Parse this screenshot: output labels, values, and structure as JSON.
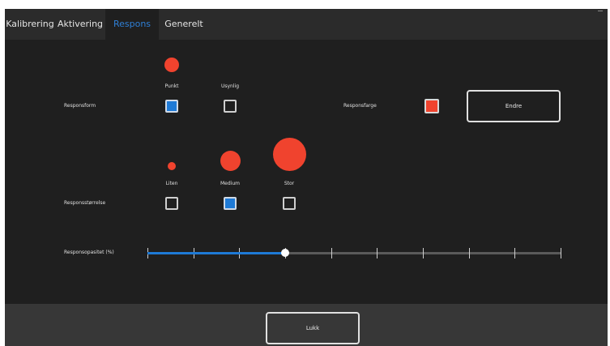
{
  "tabs": [
    {
      "label": "Kalibrering",
      "active": false
    },
    {
      "label": "Aktivering",
      "active": false
    },
    {
      "label": "Respons",
      "active": true
    },
    {
      "label": "Generelt",
      "active": false
    }
  ],
  "response_shape": {
    "label": "Responsform",
    "options": [
      {
        "label": "Punkt",
        "selected": true
      },
      {
        "label": "Usynlig",
        "selected": false
      }
    ]
  },
  "response_color": {
    "label": "Responsfarge",
    "swatch_color": "#f0432e",
    "change_button": "Endre"
  },
  "response_size": {
    "label": "Responsstørrelse",
    "options": [
      {
        "label": "Liten",
        "selected": false
      },
      {
        "label": "Medium",
        "selected": true
      },
      {
        "label": "Stor",
        "selected": false
      }
    ]
  },
  "response_opacity": {
    "label": "Responsopasitet (%)",
    "value_fraction": 0.333,
    "tick_count": 10
  },
  "footer": {
    "close_button": "Lukk"
  },
  "colors": {
    "accent": "#1e7ad6",
    "response": "#f0432e",
    "background": "#1f1f1f",
    "tabbar": "#2b2b2b",
    "footer": "#373737"
  }
}
